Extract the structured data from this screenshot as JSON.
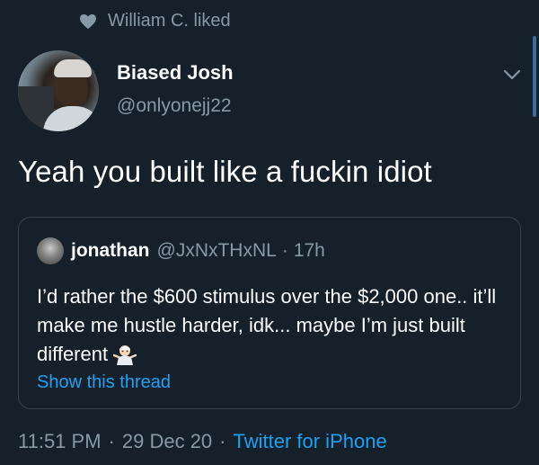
{
  "social_context": {
    "liker": "William C.",
    "action": "liked",
    "text": "William C. liked",
    "icon": "heart-icon"
  },
  "tweet": {
    "author": {
      "display_name": "Biased Josh",
      "handle": "@onlyonejj22"
    },
    "text": "Yeah you built like a fuckin idiot",
    "quoted": {
      "display_name": "jonathan",
      "handle": "@JxNxTHxNL",
      "separator": "·",
      "time": "17h",
      "body": "I’d rather the $600 stimulus over the $2,000 one.. it’ll make me hustle harder, idk... maybe I’m just built different",
      "emoji": "person-shrugging-emoji",
      "show_thread_label": "Show this thread"
    },
    "footer": {
      "time": "11:51 PM",
      "separator": "·",
      "date": "29 Dec 20",
      "source": "Twitter for iPhone"
    }
  },
  "colors": {
    "background": "#15202b",
    "text_primary": "#ffffff",
    "text_secondary": "#8899a6",
    "accent": "#1da1f2",
    "border": "#38444d"
  }
}
